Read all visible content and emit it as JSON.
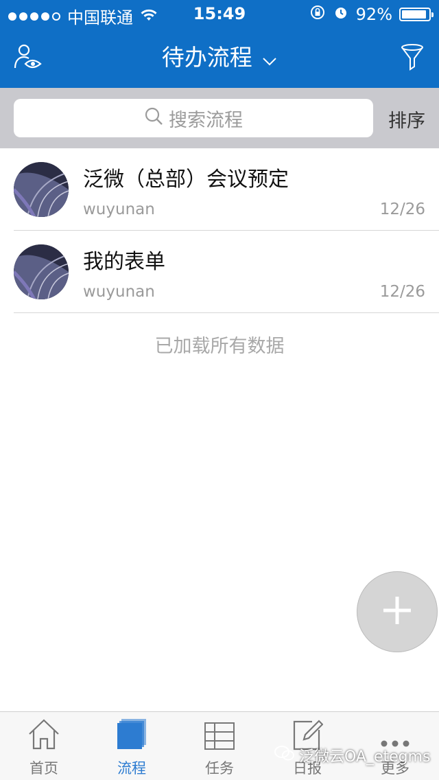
{
  "status_bar": {
    "carrier": "中国联通",
    "time": "15:49",
    "battery_percent": "92%",
    "battery_level": 0.92,
    "signal_dots_filled": 4
  },
  "header": {
    "title": "待办流程",
    "left_icon": "user-eye-icon",
    "right_icon": "filter-icon",
    "background": "#0f6fc6"
  },
  "search": {
    "placeholder": "搜索流程",
    "sort_label": "排序"
  },
  "list": {
    "items": [
      {
        "title": "泛微（总部）会议预定",
        "user": "wuyunan",
        "date": "12/26"
      },
      {
        "title": "我的表单",
        "user": "wuyunan",
        "date": "12/26"
      }
    ],
    "footer_message": "已加载所有数据"
  },
  "fab": {
    "icon": "plus-icon"
  },
  "tabbar": {
    "tabs": [
      {
        "label": "首页",
        "icon": "home-icon"
      },
      {
        "label": "流程",
        "icon": "workflow-icon",
        "active": true
      },
      {
        "label": "任务",
        "icon": "task-list-icon"
      },
      {
        "label": "日报",
        "icon": "edit-report-icon"
      },
      {
        "label": "更多",
        "icon": "more-icon"
      }
    ],
    "active_color": "#2d7cd1"
  },
  "watermark": {
    "text": "泛微云OA_etegms"
  }
}
